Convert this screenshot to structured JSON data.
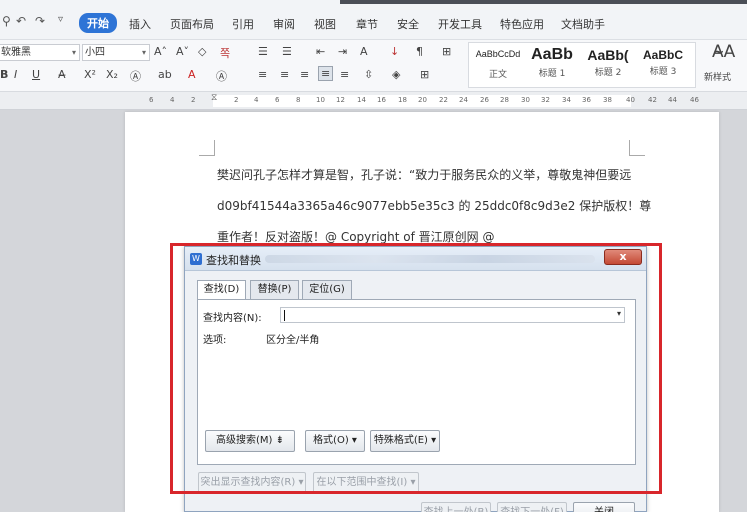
{
  "menu": {
    "active": "开始",
    "items": [
      "插入",
      "页面布局",
      "引用",
      "审阅",
      "视图",
      "章节",
      "安全",
      "开发工具",
      "特色应用",
      "文档助手"
    ]
  },
  "ribbon": {
    "font_name": "软雅黑",
    "font_size": "小四",
    "styles": [
      {
        "preview": "AaBbCcDd",
        "label": "正文"
      },
      {
        "preview": "AaBb",
        "label": "标题 1"
      },
      {
        "preview": "AaBb(",
        "label": "标题 2"
      },
      {
        "preview": "AaBbC",
        "label": "标题 3"
      }
    ],
    "new_style_label": "新样式"
  },
  "ruler": {
    "ticks": [
      "6",
      "4",
      "2",
      "2",
      "4",
      "6",
      "8",
      "10",
      "12",
      "14",
      "16",
      "18",
      "20",
      "22",
      "24",
      "26",
      "28",
      "30",
      "32",
      "34",
      "36",
      "38",
      "40",
      "42",
      "44",
      "46"
    ]
  },
  "document": {
    "lines": [
      "樊迟问孔子怎样才算是智，孔子说：“致力于服务民众的义举，尊敬鬼神但要远",
      "d09bf41544a3365a46c9077ebb5e35c3 的 25ddc0f8c9d3e2  保护版权！尊",
      "重作者！反对盗版！@ Copyright of  晋江原创网  @"
    ]
  },
  "dialog": {
    "title": "查找和替换",
    "close": "x",
    "tabs": [
      "查找(D)",
      "替换(P)",
      "定位(G)"
    ],
    "find_label": "查找内容(N):",
    "find_value": "",
    "options_label": "选项:",
    "options_value": "区分全/半角",
    "buttons": {
      "advanced": "高级搜索(M) ⇟",
      "format": "格式(O) ▾",
      "special": "特殊格式(E) ▾",
      "highlight": "突出显示查找内容(R) ▾",
      "find_in": "在以下范围中查找(I) ▾",
      "find_prev": "查找上一处(B)",
      "find_next": "查找下一处(F)",
      "close": "关闭"
    }
  },
  "colors": {
    "accent": "#2e74d6",
    "highlight_frame": "#d8262b"
  }
}
